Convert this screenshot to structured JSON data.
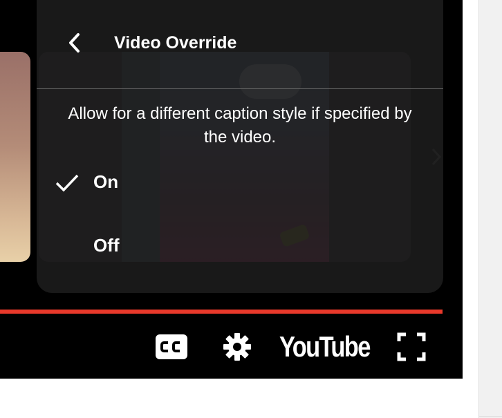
{
  "menu": {
    "title": "Video Override",
    "description": "Allow for a different caption style if specified by the video.",
    "options": [
      {
        "label": "On",
        "selected": true
      },
      {
        "label": "Off",
        "selected": false
      }
    ]
  },
  "player": {
    "logo_text": "YouTube",
    "progress_color": "#e9392b",
    "icons": [
      "back-arrow-icon",
      "checkmark-icon",
      "closed-captions-icon",
      "gear-icon",
      "fullscreen-icon",
      "chevron-right-icon"
    ]
  }
}
